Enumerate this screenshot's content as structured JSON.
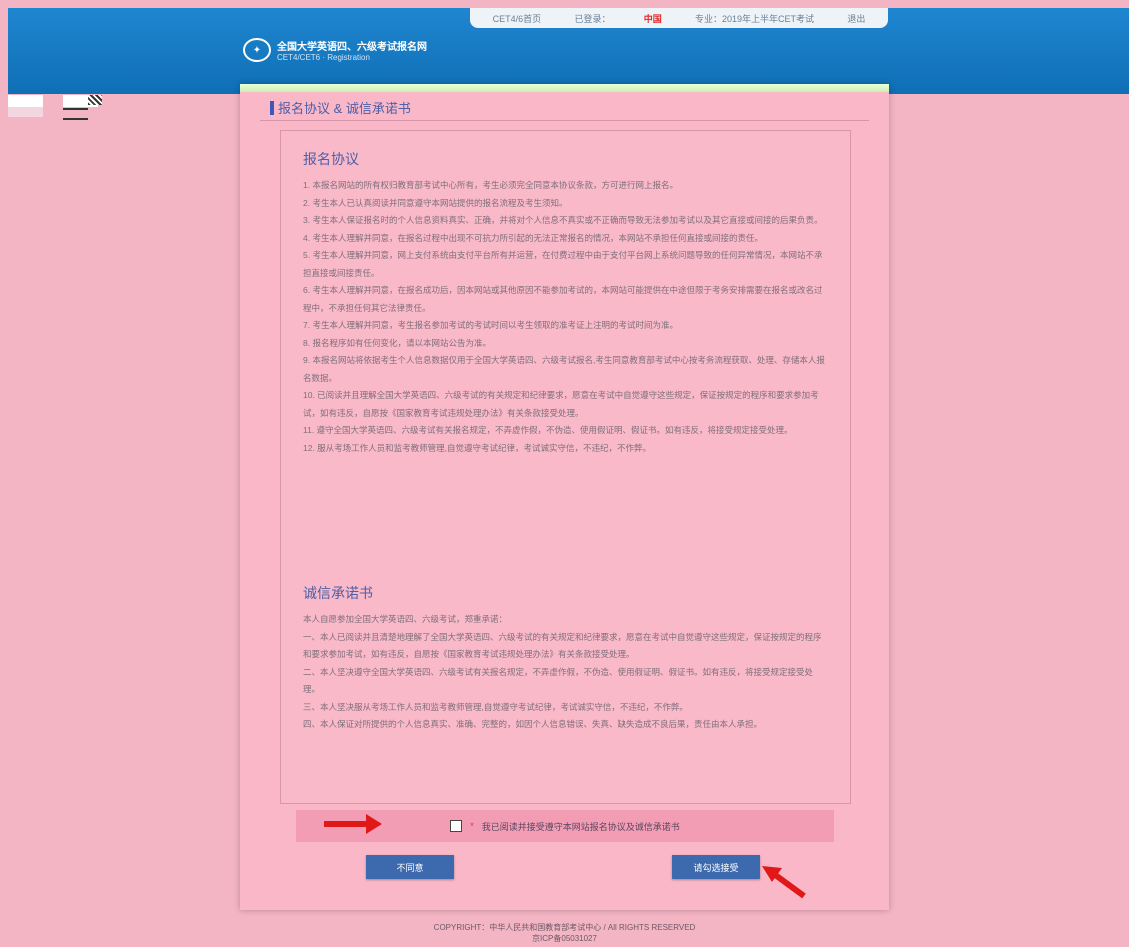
{
  "topbar": {
    "items": [
      "CET4/6首页",
      "已登录：",
      "中国",
      "专业：2019年上半年CET考试",
      "退出"
    ]
  },
  "logo": {
    "line1": "全国大学英语四、六级考试报名网",
    "line2": "CET4/CET6 · Registration"
  },
  "page_title": "报名协议 & 诚信承诺书",
  "agreement": {
    "heading": "报名协议",
    "paragraphs": [
      "1. 本报名网站的所有权归教育部考试中心所有，考生必须完全同意本协议条款，方可进行网上报名。",
      "2. 考生本人已认真阅读并同意遵守本网站提供的报名流程及考生须知。",
      "3. 考生本人保证报名时的个人信息资料真实、正确，并将对个人信息不真实或不正确而导致无法参加考试以及其它直接或间接的后果负责。",
      "4. 考生本人理解并同意，在报名过程中出现不可抗力所引起的无法正常报名的情况，本网站不承担任何直接或间接的责任。",
      "5. 考生本人理解并同意，网上支付系统由支付平台所有并运营，在付费过程中由于支付平台网上系统问题导致的任何异常情况，本网站不承担直接或间接责任。",
      "6. 考生本人理解并同意，在报名成功后，因本网站或其他原因不能参加考试的，本网站可能提供在中途但限于考务安排需要在报名或改名过程中，不承担任何其它法律责任。",
      "7. 考生本人理解并同意，考生报名参加考试的考试时间以考生领取的准考证上注明的考试时间为准。",
      "8. 报名程序如有任何变化，请以本网站公告为准。",
      "9. 本报名网站将依据考生个人信息数据仅用于全国大学英语四、六级考试报名,考生同意教育部考试中心按考务流程获取、处理、存储本人报名数据。",
      "10. 已阅读并且理解全国大学英语四、六级考试的有关规定和纪律要求，愿意在考试中自觉遵守这些规定，保证按规定的程序和要求参加考试，如有违反，自愿按《国家教育考试违规处理办法》有关条款接受处理。",
      "11. 遵守全国大学英语四、六级考试有关报名规定，不弄虚作假，不伪造、使用假证明、假证书。如有违反，将接受规定接受处理。",
      "12. 服从考场工作人员和监考教师管理,自觉遵守考试纪律，考试诚实守信，不违纪，不作弊。"
    ]
  },
  "pledge": {
    "heading": "诚信承诺书",
    "paragraphs": [
      "本人自愿参加全国大学英语四、六级考试，郑重承诺：",
      "一、本人已阅读并且清楚地理解了全国大学英语四、六级考试的有关规定和纪律要求，愿意在考试中自觉遵守这些规定，保证按规定的程序和要求参加考试，如有违反，自愿按《国家教育考试违规处理办法》有关条款接受处理。",
      "二、本人坚决遵守全国大学英语四、六级考试有关报名规定，不弄虚作假，不伪造、使用假证明、假证书。如有违反，将接受规定接受处理。",
      "三、本人坚决服从考场工作人员和监考教师管理,自觉遵守考试纪律，考试诚实守信，不违纪，不作弊。",
      "四、本人保证对所提供的个人信息真实、准确、完整的，如因个人信息错误、失真、缺失造成不良后果，责任由本人承担。"
    ]
  },
  "agree_checkbox_label": "我已阅读并接受遵守本网站报名协议及诚信承诺书",
  "buttons": {
    "disagree": "不同意",
    "agree": "请勾选接受"
  },
  "footer": {
    "line1": "COPYRIGHT：中华人民共和国教育部考试中心 / All RIGHTS RESERVED",
    "line2": "京ICP备05031027"
  },
  "colors": {
    "header": "#1478c2",
    "page_bg": "#f3b4c4",
    "panel_bg": "#f9b7c8",
    "accent": "#3e58b8",
    "arrow": "#e01818"
  }
}
